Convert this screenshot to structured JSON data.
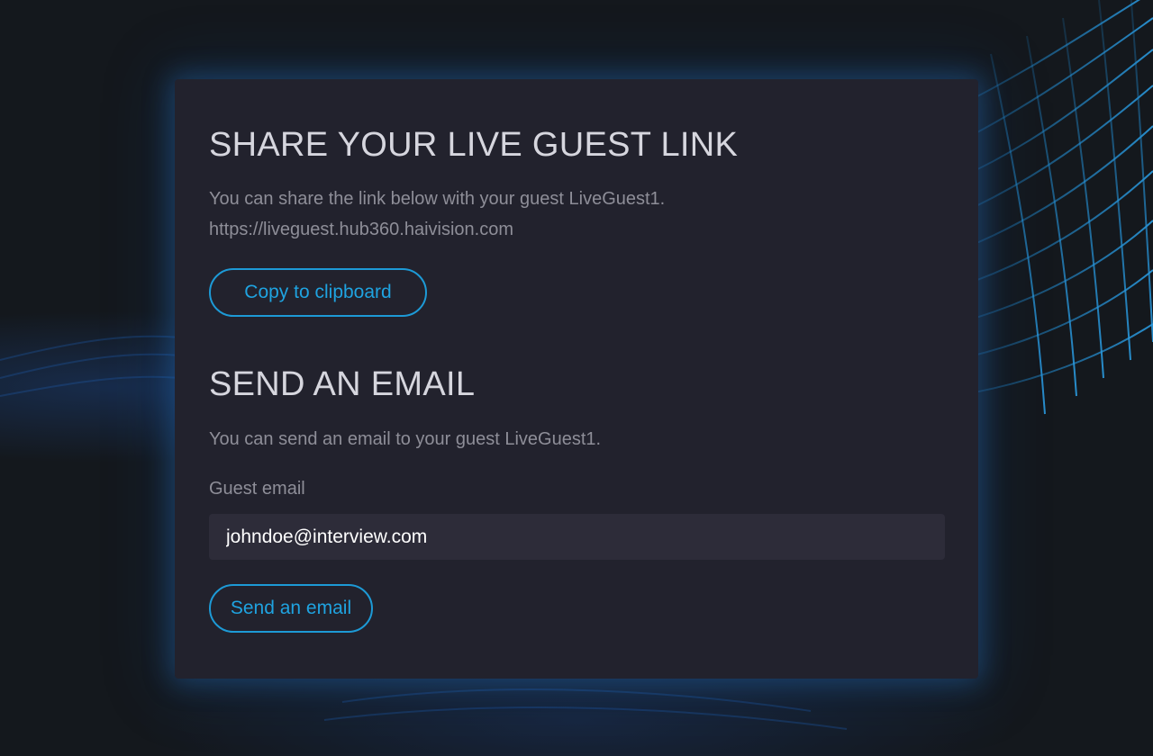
{
  "share": {
    "heading": "SHARE YOUR LIVE GUEST LINK",
    "description": "You can share the link below with your guest LiveGuest1.",
    "link": "https://liveguest.hub360.haivision.com",
    "copy_button": "Copy to clipboard"
  },
  "email": {
    "heading": "SEND AN EMAIL",
    "description": "You can send an email to your guest LiveGuest1.",
    "field_label": "Guest email",
    "field_value": "johndoe@interview.com",
    "send_button": "Send an email"
  },
  "colors": {
    "accent": "#1d9ad6",
    "card_background": "#22222d",
    "page_background": "#14181d",
    "input_background": "#2d2c39"
  }
}
